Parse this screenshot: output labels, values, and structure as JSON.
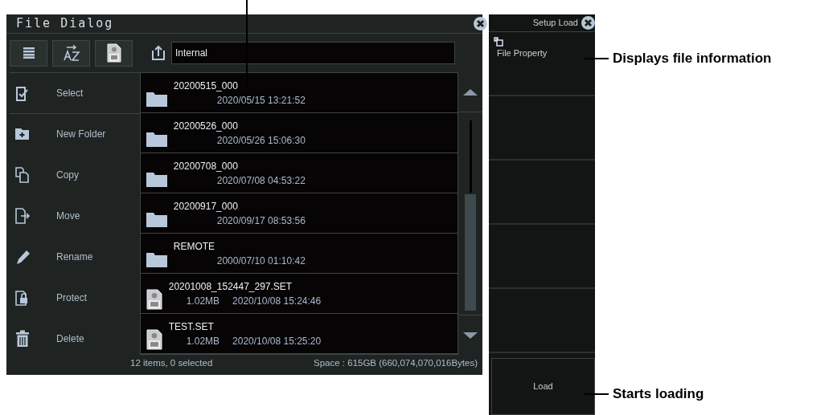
{
  "file_dialog": {
    "title": "File Dialog",
    "path": "Internal",
    "actions": [
      {
        "label": "Select"
      },
      {
        "label": "New Folder"
      },
      {
        "label": "Copy"
      },
      {
        "label": "Move"
      },
      {
        "label": "Rename"
      },
      {
        "label": "Protect"
      },
      {
        "label": "Delete"
      }
    ],
    "files": [
      {
        "kind": "folder",
        "name": "20200515_000",
        "modified": "2020/05/15  13:21:52"
      },
      {
        "kind": "folder",
        "name": "20200526_000",
        "modified": "2020/05/26  15:06:30"
      },
      {
        "kind": "folder",
        "name": "20200708_000",
        "modified": "2020/07/08  04:53:22"
      },
      {
        "kind": "folder",
        "name": "20200917_000",
        "modified": "2020/09/17  08:53:56"
      },
      {
        "kind": "folder",
        "name": "REMOTE",
        "modified": "2000/07/10  01:10:42"
      },
      {
        "kind": "set",
        "name": "20201008_152447_297.SET",
        "size": "1.02MB",
        "modified": "2020/10/08  15:24:46"
      },
      {
        "kind": "set",
        "name": "TEST.SET",
        "size": "1.02MB",
        "modified": "2020/10/08  15:25:20"
      }
    ],
    "status": "12 items, 0 selected",
    "space": "Space : 615GB (660,074,070,016Bytes)"
  },
  "setup_panel": {
    "title": "Setup Load",
    "softkeys": [
      {
        "kind": "property",
        "label": "File Property"
      },
      {
        "kind": "blank"
      },
      {
        "kind": "blank"
      },
      {
        "kind": "blank"
      },
      {
        "kind": "blank"
      },
      {
        "kind": "action",
        "label": "Load"
      }
    ]
  },
  "annotations": [
    {
      "text": "Displays file information"
    },
    {
      "text": "Starts loading"
    }
  ]
}
